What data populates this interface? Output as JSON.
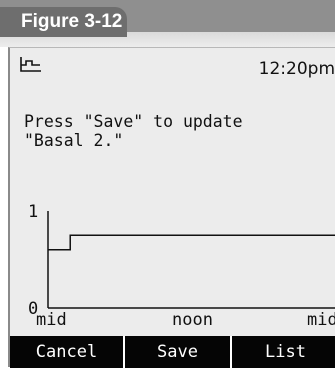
{
  "figure_label": "Figure 3-12",
  "status": {
    "icon": "basal-profile-icon",
    "time": "12:20pm"
  },
  "message": {
    "line1": "Press \"Save\" to update",
    "line2": "\"Basal 2.\""
  },
  "chart_data": {
    "type": "line",
    "step": true,
    "x_ticks": [
      "mid",
      "noon",
      "mid"
    ],
    "y_ticks": [
      "1",
      "0"
    ],
    "ylim": [
      0,
      1
    ],
    "series": [
      {
        "segments": [
          {
            "start_hour": 0,
            "value": 0.6
          },
          {
            "start_hour": 2,
            "value": 0.75
          }
        ]
      }
    ],
    "grid": false
  },
  "softkeys": {
    "left": "Cancel",
    "middle": "Save",
    "right": "List"
  }
}
